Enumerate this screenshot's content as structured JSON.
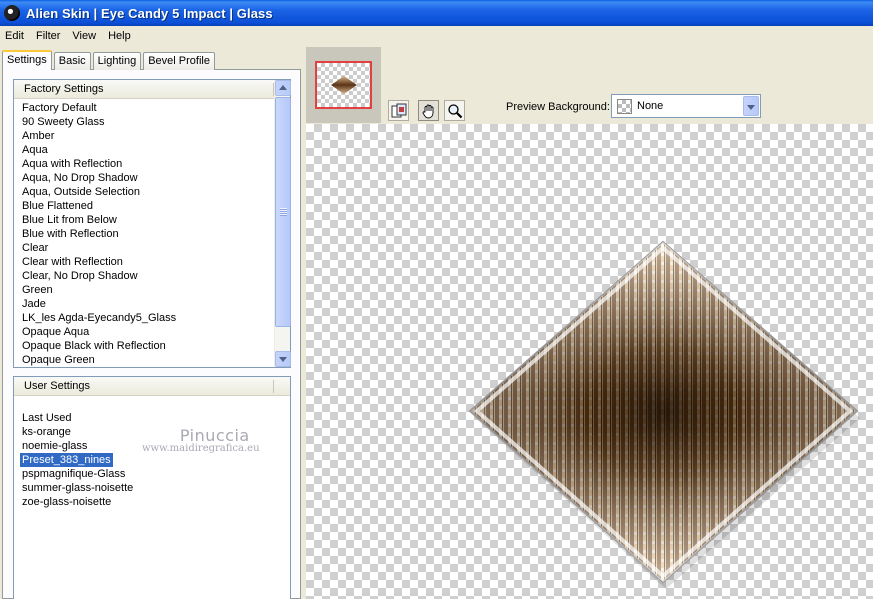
{
  "window": {
    "title": "Alien Skin  |  Eye Candy 5 Impact  |  Glass"
  },
  "menu": [
    "Edit",
    "Filter",
    "View",
    "Help"
  ],
  "tabs": [
    "Settings",
    "Basic",
    "Lighting",
    "Bevel Profile"
  ],
  "factory_settings": {
    "header": "Factory Settings",
    "items": [
      "Factory Default",
      "90 Sweety Glass",
      "Amber",
      "Aqua",
      "Aqua with Reflection",
      "Aqua, No Drop Shadow",
      "Aqua, Outside Selection",
      "Blue Flattened",
      "Blue Lit from Below",
      "Blue with Reflection",
      "Clear",
      "Clear with Reflection",
      "Clear, No Drop Shadow",
      "Green",
      "Jade",
      "LK_les Agda-Eyecandy5_Glass",
      "Opaque Aqua",
      "Opaque Black with Reflection",
      "Opaque Green"
    ]
  },
  "user_settings": {
    "header": "User Settings",
    "items": [
      "Last Used",
      "ks-orange",
      "noemie-glass",
      "Preset_383_nines",
      "pspmagnifique-Glass",
      "summer-glass-noisette",
      "zoe-glass-noisette"
    ],
    "selected": "Preset_383_nines"
  },
  "watermark": {
    "name": "Pinuccia",
    "url": "www.maidiregrafica.eu"
  },
  "preview_background": {
    "label": "Preview Background:",
    "value": "None"
  },
  "icons": {
    "preview_toggle": "preview-toggle-icon",
    "pan": "hand-icon",
    "zoom": "magnifier-icon"
  },
  "colors": {
    "titlebar": "#0b4fd6",
    "selection": "#316ac5",
    "thumb_border": "#e04040",
    "glass_dark": "#3a2410",
    "glass_light": "#f2c886"
  }
}
